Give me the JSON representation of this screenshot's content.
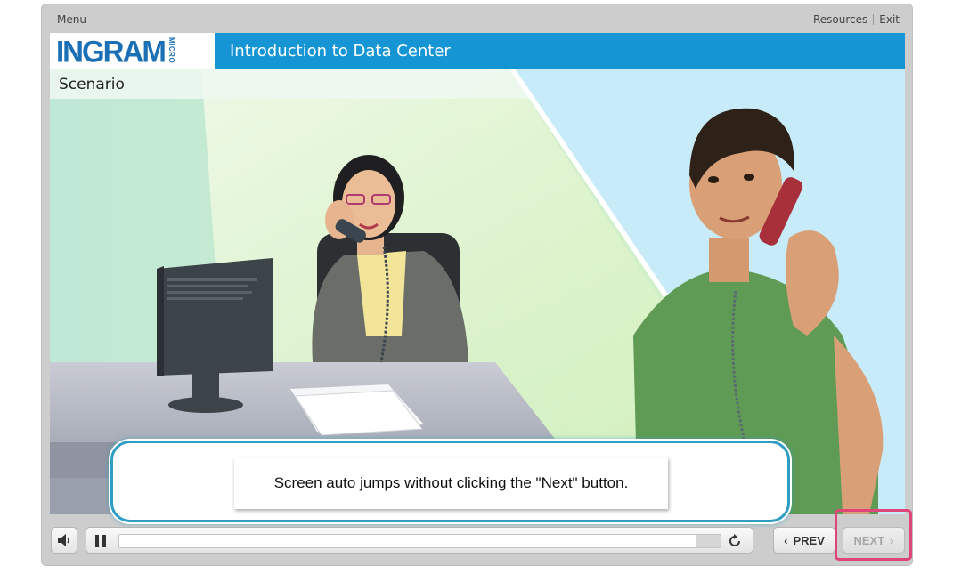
{
  "topbar": {
    "menu_label": "Menu",
    "resources_label": "Resources",
    "exit_label": "Exit"
  },
  "header": {
    "logo_text": "INGRAM",
    "logo_sub": "MICRO",
    "course_title": "Introduction to Data Center"
  },
  "slide": {
    "section_label": "Scenario",
    "caption": "Screen auto jumps without clicking the \"Next\" button."
  },
  "player": {
    "progress": 0.96,
    "prev_label": "PREV",
    "next_label": "NEXT"
  },
  "colors": {
    "brand_blue": "#1595d3",
    "logo_blue": "#1a6fb5",
    "highlight": "#e0457a"
  }
}
